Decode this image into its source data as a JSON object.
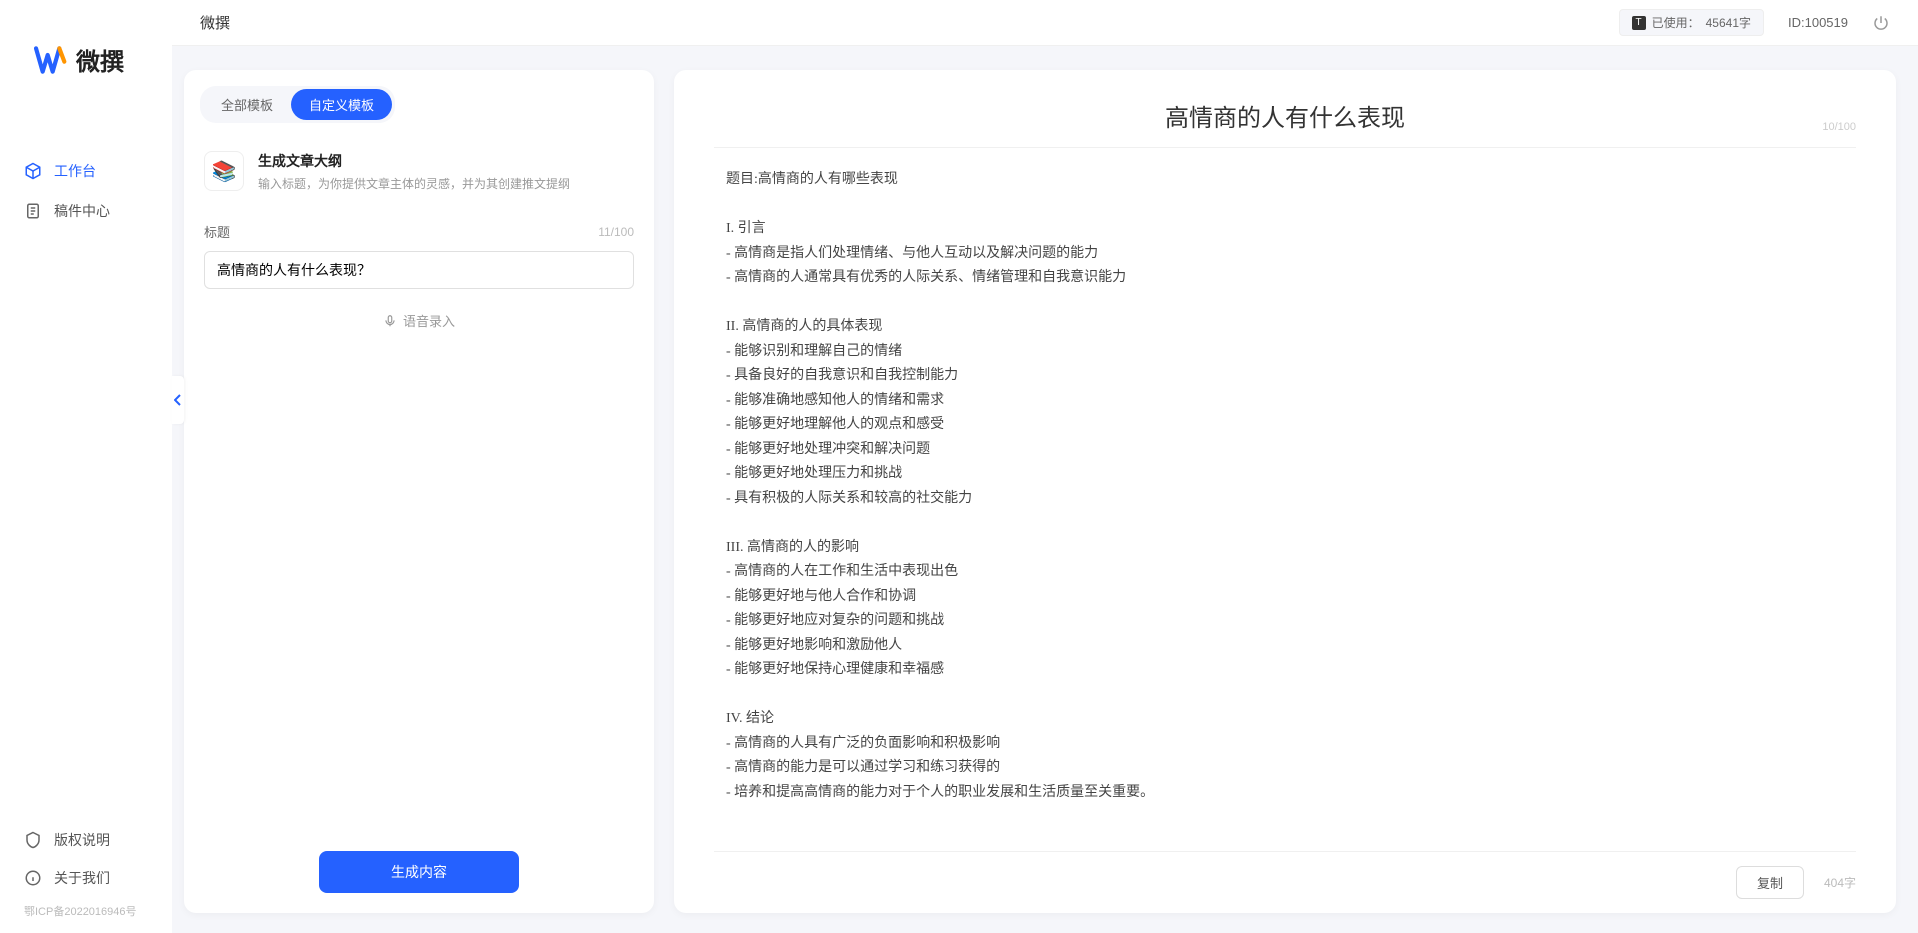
{
  "app": {
    "name": "微撰"
  },
  "sidebar": {
    "logo_text": "微撰",
    "nav": [
      {
        "label": "工作台",
        "icon": "cube-icon",
        "active": true
      },
      {
        "label": "稿件中心",
        "icon": "doc-icon",
        "active": false
      }
    ],
    "bottom": [
      {
        "label": "版权说明",
        "icon": "shield-icon"
      },
      {
        "label": "关于我们",
        "icon": "info-icon"
      }
    ],
    "icp": "鄂ICP备2022016946号"
  },
  "topbar": {
    "title": "微撰",
    "usage_prefix": "已使用：",
    "usage_value": "45641字",
    "user_id": "ID:100519"
  },
  "left": {
    "tabs": [
      {
        "label": "全部模板",
        "active": false
      },
      {
        "label": "自定义模板",
        "active": true
      }
    ],
    "template": {
      "name": "生成文章大纲",
      "desc": "输入标题，为你提供文章主体的灵感，并为其创建推文提纲",
      "thumb_emoji": "📚"
    },
    "title_label": "标题",
    "title_count": "11/100",
    "title_value": "高情商的人有什么表现？",
    "voice_label": "语音录入",
    "generate_label": "生成内容"
  },
  "right": {
    "title": "高情商的人有什么表现",
    "title_count": "10/100",
    "body": "题目:高情商的人有哪些表现\n\nI. 引言\n- 高情商是指人们处理情绪、与他人互动以及解决问题的能力\n- 高情商的人通常具有优秀的人际关系、情绪管理和自我意识能力\n\nII. 高情商的人的具体表现\n- 能够识别和理解自己的情绪\n- 具备良好的自我意识和自我控制能力\n- 能够准确地感知他人的情绪和需求\n- 能够更好地理解他人的观点和感受\n- 能够更好地处理冲突和解决问题\n- 能够更好地处理压力和挑战\n- 具有积极的人际关系和较高的社交能力\n\nIII. 高情商的人的影响\n- 高情商的人在工作和生活中表现出色\n- 能够更好地与他人合作和协调\n- 能够更好地应对复杂的问题和挑战\n- 能够更好地影响和激励他人\n- 能够更好地保持心理健康和幸福感\n\nIV. 结论\n- 高情商的人具有广泛的负面影响和积极影响\n- 高情商的能力是可以通过学习和练习获得的\n- 培养和提高高情商的能力对于个人的职业发展和生活质量至关重要。",
    "copy_label": "复制",
    "word_count": "404字"
  }
}
